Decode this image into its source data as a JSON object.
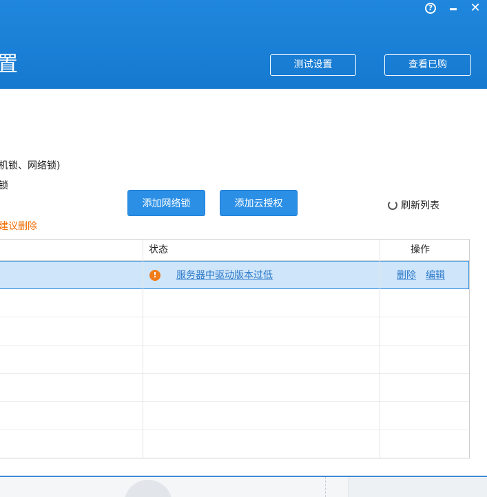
{
  "window": {
    "title": "置",
    "controls": {
      "help": "?",
      "minimize": "–",
      "close": "✕"
    }
  },
  "header": {
    "test_settings_label": "测试设置",
    "view_purchased_label": "查看已购"
  },
  "info": {
    "line1": "机锁、网络锁)",
    "line2": "锁",
    "warning": "建议删除"
  },
  "toolbar": {
    "add_network_lock_label": "添加网络锁",
    "add_cloud_auth_label": "添加云授权",
    "refresh_label": "刷新列表"
  },
  "table": {
    "columns": {
      "status": "状态",
      "actions": "操作"
    },
    "rows": [
      {
        "status_text": "服务器中驱动版本过低",
        "delete_label": "删除",
        "edit_label": "编辑"
      }
    ]
  },
  "colors": {
    "header_blue": "#1679d0",
    "button_blue": "#2b8fe6",
    "warning_orange": "#f06c00",
    "link_blue": "#2b78c9",
    "selected_row": "#cfe6fa"
  }
}
